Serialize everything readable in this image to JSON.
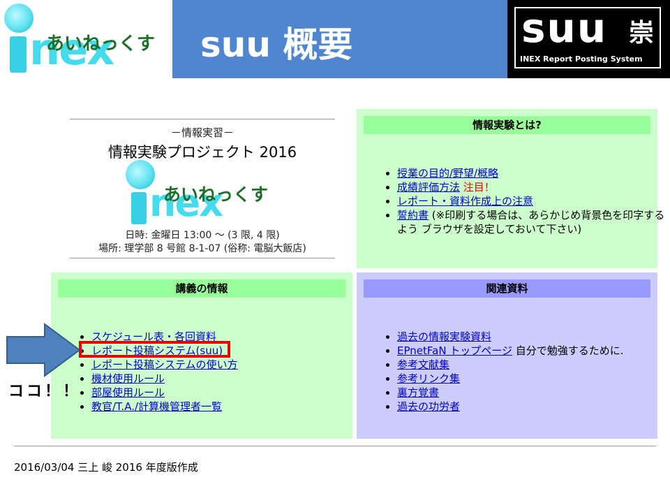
{
  "header": {
    "logo_jp": "あいねっくす",
    "logo_nex": "nex",
    "title": "suu 概要",
    "suu_word": "suu",
    "suu_kanji": "崇",
    "suu_sub": "INEX Report Posting System"
  },
  "intro": {
    "subtitle": "－情報実習－",
    "title": "情報実験プロジェクト 2016",
    "logo_jp": "あいねっくす",
    "logo_nex": "nex",
    "schedule": "日時: 金曜日 13:00 ～ (3 限, 4 限)",
    "place": "場所: 理学部 8 号館 8-1-07 (俗称: 電脳大飯店)"
  },
  "about": {
    "heading": "情報実験とは?",
    "items": [
      {
        "link": "授業の目的/野望/概略",
        "note": "",
        "alert": ""
      },
      {
        "link": "成績評価方法",
        "note": "",
        "alert": "注目！"
      },
      {
        "link": "レポート・資料作成上の注意",
        "note": "",
        "alert": ""
      },
      {
        "link": "誓約書",
        "note": "(※印刷する場合は、あらかじめ背景色を印字するよう ブラウザを設定しておいて下さい)",
        "alert": ""
      }
    ]
  },
  "lecture": {
    "heading": "講義の情報",
    "items": [
      {
        "link": "スケジュール表・各回資料"
      },
      {
        "link": "レポート投稿システム(suu)"
      },
      {
        "link": "レポート投稿システムの使い方"
      },
      {
        "link": "機材使用ルール"
      },
      {
        "link": "部屋使用ルール"
      },
      {
        "link": "教官/T.A./計算機管理者一覧"
      }
    ]
  },
  "related": {
    "heading": "関連資料",
    "items": [
      {
        "link": "過去の情報実験資料",
        "note": ""
      },
      {
        "link": "EPnetFaN トップページ",
        "note": "自分で勉強するために."
      },
      {
        "link": "参考文献集",
        "note": ""
      },
      {
        "link": "参考リンク集",
        "note": ""
      },
      {
        "link": "裏方覚書",
        "note": ""
      },
      {
        "link": "過去の功労者",
        "note": ""
      }
    ]
  },
  "annotation": {
    "callout": "ココ！！",
    "arrow_color": "#4f81bd",
    "highlight_color": "#e60000"
  },
  "footer": {
    "text": "2016/03/04 三上 峻 2016 年度版作成"
  },
  "colors": {
    "title_band": "#4f86cf",
    "panel_green": "#ccffcc",
    "panel_green_header": "#99ff99",
    "panel_purple": "#ccccff",
    "panel_purple_header": "#9999ff",
    "link": "#0000cc"
  }
}
